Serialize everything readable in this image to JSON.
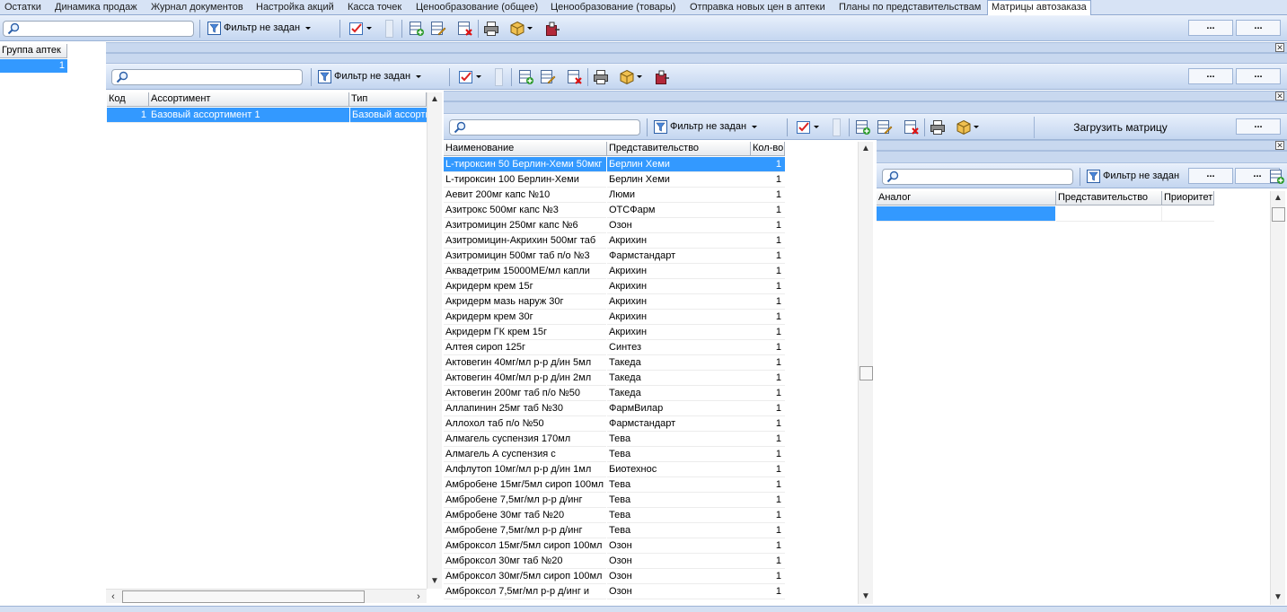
{
  "tabs": [
    {
      "label": "Остатки"
    },
    {
      "label": "Динамика продаж"
    },
    {
      "label": "Журнал документов"
    },
    {
      "label": "Настройка акций"
    },
    {
      "label": "Касса точек"
    },
    {
      "label": "Ценообразование (общее)"
    },
    {
      "label": "Ценообразование (товары)"
    },
    {
      "label": "Отправка новых цен в аптеки"
    },
    {
      "label": "Планы по представительствам"
    },
    {
      "label": "Матрицы автозаказа",
      "active": true
    }
  ],
  "toolbar": {
    "filter_label": "Фильтр не задан",
    "ellipsis": "...",
    "load_matrix_label": "Загрузить матрицу"
  },
  "pharmacy_group": {
    "header": "Группа аптек",
    "value": "1"
  },
  "assortment": {
    "columns": [
      "Код",
      "Ассортимент",
      "Тип"
    ],
    "rows": [
      {
        "code": "1",
        "name": "Базовый ассортимент 1",
        "type": "Базовый ассорти"
      }
    ]
  },
  "products": {
    "columns": [
      "Наименование",
      "Представительство",
      "Кол-во"
    ],
    "rows": [
      {
        "name": "L-тироксин 50 Берлин-Хеми 50мкг",
        "rep": "Берлин Хеми",
        "qty": "1"
      },
      {
        "name": "L-тироксин 100 Берлин-Хеми",
        "rep": "Берлин Хеми",
        "qty": "1"
      },
      {
        "name": "Аевит 200мг капс №10",
        "rep": "Люми",
        "qty": "1"
      },
      {
        "name": "Азитрокс 500мг капс №3",
        "rep": "ОТСФарм",
        "qty": "1"
      },
      {
        "name": "Азитромицин 250мг капс №6",
        "rep": "Озон",
        "qty": "1"
      },
      {
        "name": "Азитромицин-Акрихин 500мг таб",
        "rep": "Акрихин",
        "qty": "1"
      },
      {
        "name": "Азитромицин 500мг таб п/о №3",
        "rep": "Фармстандарт",
        "qty": "1"
      },
      {
        "name": "Аквадетрим 15000МЕ/мл капли",
        "rep": "Акрихин",
        "qty": "1"
      },
      {
        "name": "Акридерм крем 15г",
        "rep": "Акрихин",
        "qty": "1"
      },
      {
        "name": "Акридерм мазь наруж 30г",
        "rep": "Акрихин",
        "qty": "1"
      },
      {
        "name": "Акридерм крем 30г",
        "rep": "Акрихин",
        "qty": "1"
      },
      {
        "name": "Акридерм ГК крем 15г",
        "rep": "Акрихин",
        "qty": "1"
      },
      {
        "name": "Алтея сироп 125г",
        "rep": "Синтез",
        "qty": "1"
      },
      {
        "name": "Актовегин 40мг/мл р-р д/ин 5мл",
        "rep": "Такеда",
        "qty": "1"
      },
      {
        "name": "Актовегин 40мг/мл р-р д/ин 2мл",
        "rep": "Такеда",
        "qty": "1"
      },
      {
        "name": "Актовегин 200мг таб п/о №50",
        "rep": "Такеда",
        "qty": "1"
      },
      {
        "name": "Аллапинин 25мг таб №30",
        "rep": "ФармВилар",
        "qty": "1"
      },
      {
        "name": "Аллохол таб п/о №50",
        "rep": "Фармстандарт",
        "qty": "1"
      },
      {
        "name": "Алмагель суспензия 170мл",
        "rep": "Тева",
        "qty": "1"
      },
      {
        "name": "Алмагель А суспензия с",
        "rep": "Тева",
        "qty": "1"
      },
      {
        "name": "Алфлутоп 10мг/мл р-р д/ин 1мл",
        "rep": "Биотехнос",
        "qty": "1"
      },
      {
        "name": "Амбробене 15мг/5мл сироп 100мл",
        "rep": "Тева",
        "qty": "1"
      },
      {
        "name": "Амбробене 7,5мг/мл р-р д/инг",
        "rep": "Тева",
        "qty": "1"
      },
      {
        "name": "Амбробене 30мг таб №20",
        "rep": "Тева",
        "qty": "1"
      },
      {
        "name": "Амбробене 7,5мг/мл р-р д/инг",
        "rep": "Тева",
        "qty": "1"
      },
      {
        "name": "Амброксол 15мг/5мл сироп 100мл",
        "rep": "Озон",
        "qty": "1"
      },
      {
        "name": "Амброксол 30мг таб №20",
        "rep": "Озон",
        "qty": "1"
      },
      {
        "name": "Амброксол 30мг/5мл сироп 100мл",
        "rep": "Озон",
        "qty": "1"
      },
      {
        "name": "Амброксол 7,5мг/мл р-р д/инг и",
        "rep": "Озон",
        "qty": "1"
      }
    ]
  },
  "analogs": {
    "columns": [
      "Аналог",
      "Представительство",
      "Приоритет"
    ]
  }
}
